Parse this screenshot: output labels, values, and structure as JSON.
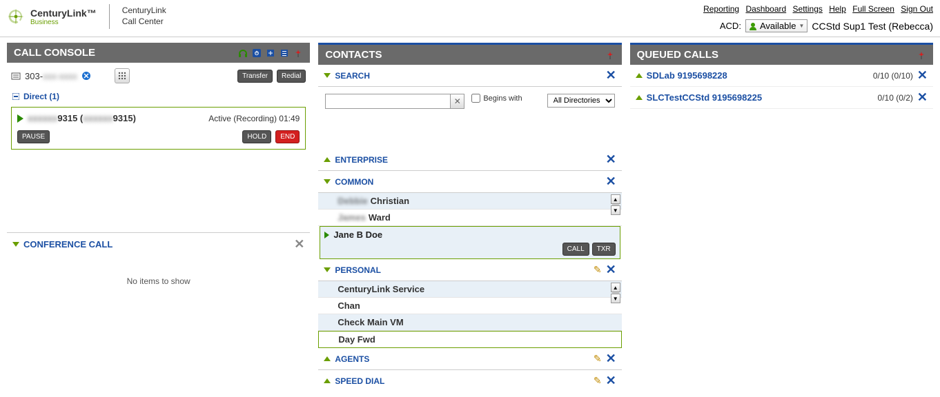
{
  "header": {
    "brand_main": "CenturyLink",
    "brand_sub": "Business",
    "app_line1": "CenturyLink",
    "app_line2": "Call Center",
    "links": [
      "Reporting",
      "Dashboard",
      "Settings",
      "Help",
      "Full Screen",
      "Sign Out"
    ],
    "acd_label": "ACD:",
    "acd_status": "Available",
    "user_name": "CCStd Sup1 Test (Rebecca)"
  },
  "call_console": {
    "title": "CALL CONSOLE",
    "dial_prefix": "303-",
    "transfer_btn": "Transfer",
    "redial_btn": "Redial",
    "direct_label": "Direct (1)",
    "call": {
      "number_masked": "9315",
      "secondary_masked": "9315)",
      "status": "Active (Recording) 01:49",
      "pause_btn": "PAUSE",
      "hold_btn": "HOLD",
      "end_btn": "END"
    },
    "conference_title": "CONFERENCE CALL",
    "conference_empty": "No items to show"
  },
  "contacts": {
    "title": "CONTACTS",
    "search": {
      "title": "SEARCH",
      "begins_with": "Begins with",
      "directory": "All Directories"
    },
    "enterprise": {
      "title": "ENTERPRISE"
    },
    "common": {
      "title": "COMMON",
      "items": [
        {
          "pre": "Debbie",
          "last": "Christian"
        },
        {
          "pre": "James",
          "last": "Ward"
        }
      ],
      "selected": {
        "name": "Jane B Doe",
        "call_btn": "CALL",
        "txr_btn": "TXR"
      }
    },
    "personal": {
      "title": "PERSONAL",
      "items": [
        "CenturyLink Service",
        "Chan",
        "Check Main VM",
        "Day Fwd"
      ]
    },
    "agents": {
      "title": "AGENTS"
    },
    "speed_dial": {
      "title": "SPEED DIAL"
    }
  },
  "queued": {
    "title": "QUEUED CALLS",
    "rows": [
      {
        "name": "SDLab 9195698228",
        "stats": "0/10 (0/10)"
      },
      {
        "name": "SLCTestCCStd 9195698225",
        "stats": "0/10 (0/2)"
      }
    ]
  }
}
